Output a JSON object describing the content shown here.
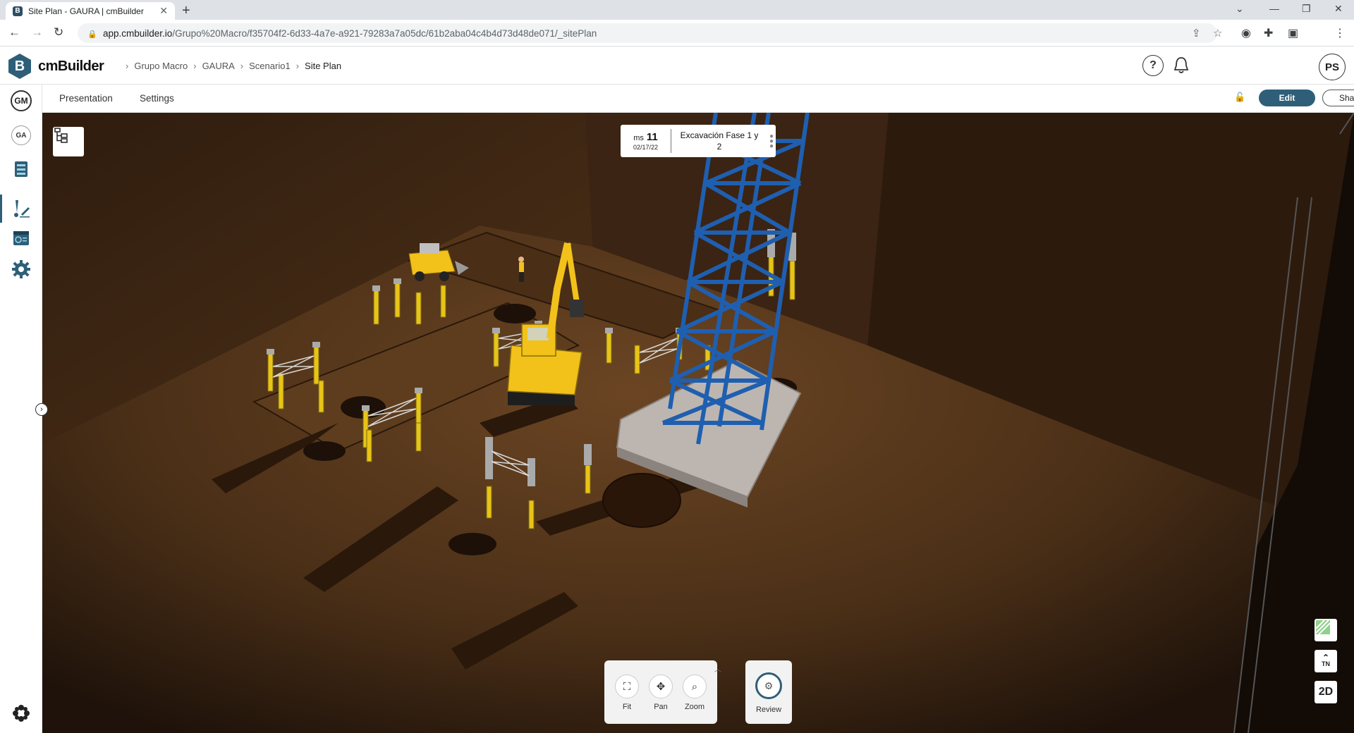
{
  "browser": {
    "tab_title": "Site Plan - GAURA | cmBuilder",
    "tab_favicon": "B",
    "url_host": "app.cmbuilder.io",
    "url_path": "/Grupo%20Macro/f35704f2-6d33-4a7e-a921-79283a7a05dc/61b2aba04c4b4d73d48de071/_sitePlan"
  },
  "app": {
    "logo_letter": "B",
    "name": "cmBuilder",
    "breadcrumb": [
      "Grupo Macro",
      "GAURA",
      "Scenario1",
      "Site Plan"
    ],
    "help_icon": "?",
    "user_initials": "PS"
  },
  "rail": {
    "org_initials": "GM",
    "project_initials": "GA"
  },
  "subheader": {
    "tabs": [
      "Presentation",
      "Settings"
    ],
    "edit_label": "Edit",
    "share_label": "Share"
  },
  "milestone": {
    "prefix": "ms",
    "number": "11",
    "date": "02/17/22",
    "name_line1": "Excavación Fase 1 y",
    "name_line2": "2"
  },
  "tools": {
    "fit": "Fit",
    "pan": "Pan",
    "zoom": "Zoom",
    "review": "Review"
  },
  "view_controls": {
    "north": "TN",
    "mode": "2D"
  },
  "colors": {
    "brand": "#2f5f78",
    "ground": "#5a3a1e",
    "crane": "#1f5fb0",
    "machine": "#f2c21b"
  }
}
